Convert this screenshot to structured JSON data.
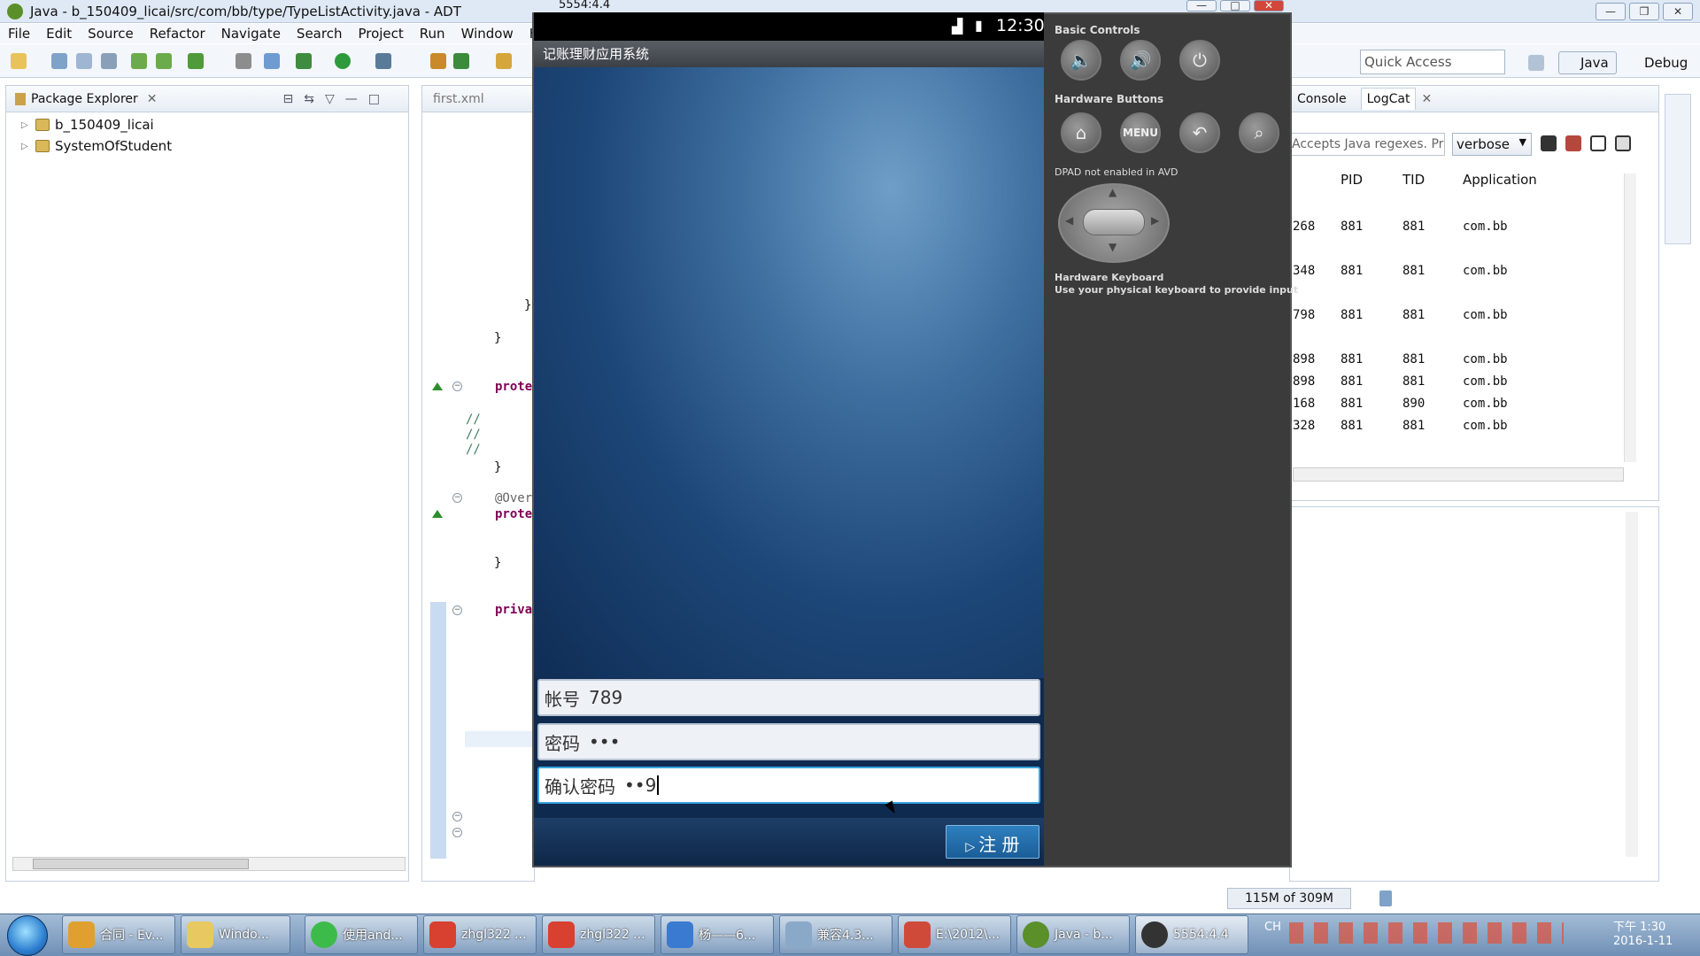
{
  "window": {
    "title": "Java - b_150409_licai/src/com/bb/type/TypeListActivity.java - ADT"
  },
  "menu": [
    "File",
    "Edit",
    "Source",
    "Refactor",
    "Navigate",
    "Search",
    "Project",
    "Run",
    "Window",
    "Help"
  ],
  "quick_access": {
    "placeholder": "Quick Access"
  },
  "perspectives": {
    "java": "Java",
    "debug": "Debug"
  },
  "package_explorer": {
    "tab": "Package Explorer",
    "items": [
      "b_150409_licai",
      "SystemOfStudent"
    ]
  },
  "editor": {
    "tab": "first.xml",
    "lines": {
      "l1": "}",
      "l2": "}",
      "prote": "prote",
      "c1": "//",
      "c2": "//",
      "c3": "//",
      "over": "@Over",
      "prote2": "prote",
      "close2": "}",
      "close3": "}",
      "priva": "priva"
    }
  },
  "emulator": {
    "title": "5554:4.4",
    "clock": "12:30",
    "app_title": "记账理财应用系统",
    "fields": [
      {
        "label": "帐号",
        "value": "789"
      },
      {
        "label": "密码",
        "value": "•••"
      },
      {
        "label": "确认密码",
        "value": "••9"
      }
    ],
    "register_button": "注 册",
    "controls": {
      "basic": "Basic Controls",
      "hardware": "Hardware Buttons",
      "menu": "MENU",
      "dpad": "DPAD not enabled in AVD",
      "keyboard_title": "Hardware Keyboard",
      "keyboard_desc": "Use your physical keyboard to provide input"
    }
  },
  "logcat": {
    "tabs": {
      "console": "Console",
      "logcat": "LogCat"
    },
    "filter_placeholder": "Accepts Java regexes. Pre",
    "level": "verbose",
    "headers": {
      "pid": "PID",
      "tid": "TID",
      "app": "Application"
    },
    "rows": [
      {
        "c0": "268",
        "pid": "881",
        "tid": "881",
        "app": "com.bb"
      },
      {
        "c0": "348",
        "pid": "881",
        "tid": "881",
        "app": "com.bb"
      },
      {
        "c0": "798",
        "pid": "881",
        "tid": "881",
        "app": "com.bb"
      },
      {
        "c0": "898",
        "pid": "881",
        "tid": "881",
        "app": "com.bb"
      },
      {
        "c0": "898",
        "pid": "881",
        "tid": "881",
        "app": "com.bb"
      },
      {
        "c0": "168",
        "pid": "881",
        "tid": "890",
        "app": "com.bb"
      },
      {
        "c0": "328",
        "pid": "881",
        "tid": "881",
        "app": "com.bb"
      }
    ]
  },
  "heap": "115M of 309M",
  "taskbar": {
    "items": [
      "合同 - Ev...",
      "Windo...",
      "使用and...",
      "zhgl322 ...",
      "zhgl322 ...",
      "杨——6...",
      "兼容4.3...",
      "E:\\2012\\...",
      "Java - b...",
      "5554:4.4"
    ],
    "lang": "CH",
    "time": "下午 1:30",
    "date": "2016-1-11"
  }
}
